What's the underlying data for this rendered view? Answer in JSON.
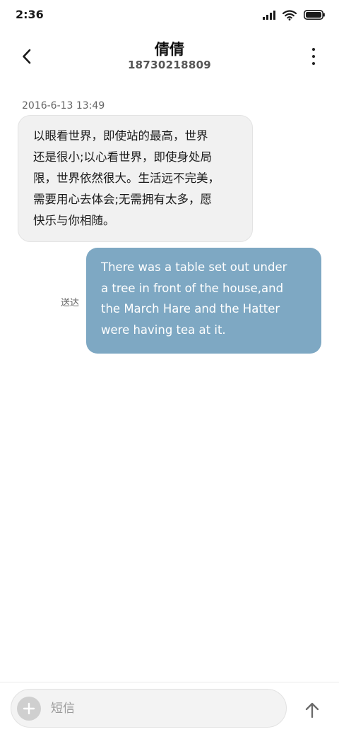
{
  "status_bar": {
    "time": "2:36",
    "icons": [
      "signal-icon",
      "wifi-icon",
      "battery-icon"
    ]
  },
  "header": {
    "contact_name": "倩倩",
    "contact_number": "18730218809",
    "back_icon": "chevron-left-icon",
    "more_icon": "more-vertical-icon"
  },
  "messages": [
    {
      "direction": "incoming",
      "timestamp": "2016-6-13 13:49",
      "lines": [
        "以眼看世界，即使站的最高，世界",
        "还是很小;以心看世界，即使身处局",
        "限，世界依然很大。生活远不完美，",
        "需要用心去体会;无需拥有太多，愿",
        "快乐与你相随。"
      ]
    },
    {
      "direction": "outgoing",
      "status": "送达",
      "lines": [
        "There was a table set out under",
        "a tree in front of the house,and",
        "the March Hare and the Hatter",
        "were having tea at it."
      ]
    }
  ],
  "composer": {
    "placeholder": "短信",
    "value": "",
    "add_icon": "plus-icon",
    "send_icon": "arrow-up-icon"
  },
  "colors": {
    "incoming_bubble": "#f1f1f1",
    "outgoing_bubble": "#7ea8c3",
    "background": "#ffffff"
  }
}
